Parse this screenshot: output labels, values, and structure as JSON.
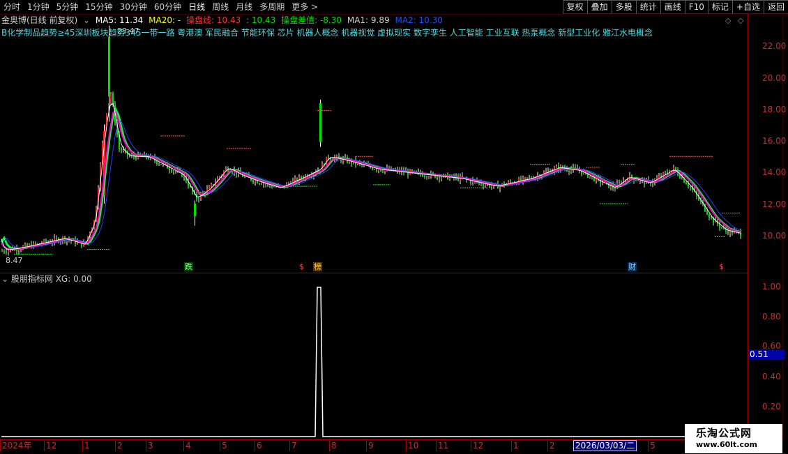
{
  "toolbar": {
    "periods": [
      "分时",
      "1分钟",
      "5分钟",
      "15分钟",
      "30分钟",
      "60分钟",
      "日线",
      "周线",
      "月线",
      "多周期",
      "更多 >"
    ],
    "active_period": "日线",
    "buttons": [
      "复权",
      "叠加",
      "多股",
      "统计",
      "画线",
      "F10",
      "标记",
      "+自选",
      "返回"
    ]
  },
  "chart": {
    "stock": "金奥博(日线 前复权)",
    "ma5_label": "MA5: 11.34",
    "ma20_label": "MA20: -",
    "line1_label": "操盘线: 10.43",
    "line1_sep": ": 10.43",
    "line2_label": "操盘差值: -8.30",
    "ma1_label": "MA1: 9.89",
    "ma2_label": "MA2: 10.30",
    "concepts": "B化学制品趋势≥45深圳板块趋势345一带一路 粤港澳 军民融合 节能环保 芯片 机器人概念 机器视觉 虚拟现实 数字孪生 人工智能 工业互联 热泵概念 新型工业化 雅江水电概念",
    "high_price": "23.47",
    "low_price": "8.47",
    "price_ticks": [
      "22.00",
      "20.00",
      "18.00",
      "16.00",
      "14.00",
      "12.00",
      "10.00"
    ],
    "markers": [
      "跌",
      "$",
      "榜",
      "财",
      "$"
    ]
  },
  "indicator": {
    "title": "股朋指标网 XG: 0.00",
    "ticks": [
      "1.00",
      "0.80",
      "0.60",
      "0.40",
      "0.20"
    ],
    "cursor_value": "0.51"
  },
  "date_axis": {
    "labels": [
      "2024年",
      "12",
      "1",
      "2",
      "3",
      "4",
      "5",
      "6",
      "7",
      "8",
      "9",
      "10",
      "11",
      "12",
      "1",
      "2",
      "5"
    ],
    "current_date": "2026/03/03/二"
  },
  "watermark": {
    "title": "乐淘公式网",
    "url": "www.60lt.com"
  },
  "colors": {
    "up": "#ff3030",
    "down": "#00e000",
    "ma5": "#ffffff",
    "ma_line": "#ff00ff",
    "ma2": "#2040ff",
    "cyan_text": "#4fd8e0",
    "axis": "#aa0000"
  }
}
